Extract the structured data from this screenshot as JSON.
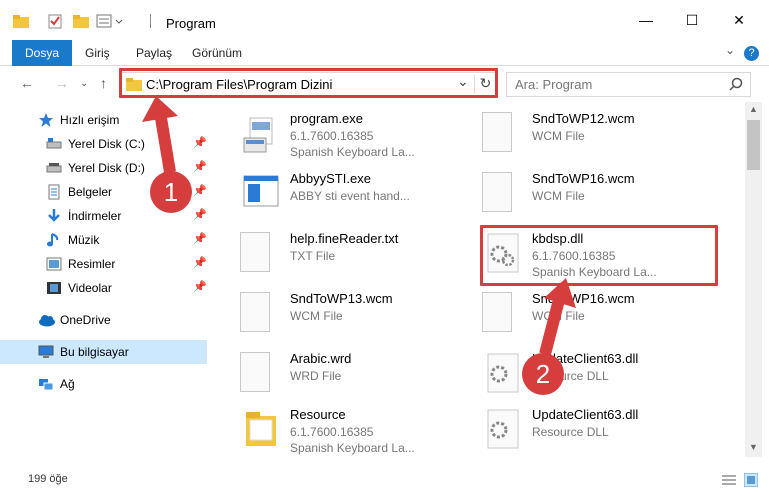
{
  "window": {
    "title": "Program",
    "minimize": "—",
    "maximize": "☐",
    "close": "✕"
  },
  "ribbon": {
    "tabs": [
      "Dosya",
      "Giriş",
      "Paylaş",
      "Görünüm"
    ],
    "expand": "⌄",
    "help": "?"
  },
  "address": {
    "path": "C:\\Program Files\\Program Dizini",
    "dropdown": "⌄",
    "refresh": "↻"
  },
  "search": {
    "placeholder": "Ara: Program"
  },
  "sidebar": {
    "items": [
      {
        "label": "Hızlı erişim",
        "icon": "star-icon"
      },
      {
        "label": "Yerel Disk (C:)",
        "icon": "drive-icon",
        "pinned": true
      },
      {
        "label": "Yerel Disk (D:)",
        "icon": "drive-icon",
        "pinned": true
      },
      {
        "label": "Belgeler",
        "icon": "documents-icon",
        "pinned": true
      },
      {
        "label": "İndirmeler",
        "icon": "download-icon",
        "pinned": true
      },
      {
        "label": "Müzik",
        "icon": "music-icon",
        "pinned": true
      },
      {
        "label": "Resimler",
        "icon": "pictures-icon",
        "pinned": true
      },
      {
        "label": "Videolar",
        "icon": "videos-icon",
        "pinned": true
      },
      {
        "label": "OneDrive",
        "icon": "cloud-icon"
      },
      {
        "label": "Bu bilgisayar",
        "icon": "computer-icon",
        "selected": true
      },
      {
        "label": "Ağ",
        "icon": "network-icon"
      }
    ]
  },
  "files": {
    "left": [
      {
        "name": "program.exe",
        "line2": "6.1.7600.16385",
        "line3": "Spanish Keyboard La..."
      },
      {
        "name": "AbbyySTI.exe",
        "line2": "ABBY sti event hand...",
        "line3": ""
      },
      {
        "name": "help.fineReader.txt",
        "line2": "TXT File",
        "line3": ""
      },
      {
        "name": "SndToWP13.wcm",
        "line2": "WCM File",
        "line3": ""
      },
      {
        "name": "Arabic.wrd",
        "line2": "WRD File",
        "line3": ""
      },
      {
        "name": "Resource",
        "line2": "6.1.7600.16385",
        "line3": "Spanish Keyboard La..."
      }
    ],
    "right": [
      {
        "name": "SndToWP12.wcm",
        "line2": "WCM File",
        "line3": ""
      },
      {
        "name": "SndToWP16.wcm",
        "line2": "WCM File",
        "line3": ""
      },
      {
        "name": "kbdsp.dll",
        "line2": "6.1.7600.16385",
        "line3": "Spanish Keyboard La..."
      },
      {
        "name": "SndToWP16.wcm",
        "line2": "WCM File",
        "line3": ""
      },
      {
        "name": "UpdateClient63.dll",
        "line2": "Resource DLL",
        "line3": ""
      },
      {
        "name": "UpdateClient63.dll",
        "line2": "Resource DLL",
        "line3": ""
      }
    ]
  },
  "status": {
    "count": "199 öğe"
  },
  "annotations": {
    "badge1": "1",
    "badge2": "2"
  },
  "colors": {
    "accent": "#1979ca",
    "highlight": "#d63d3d",
    "selection": "#cce8ff"
  }
}
